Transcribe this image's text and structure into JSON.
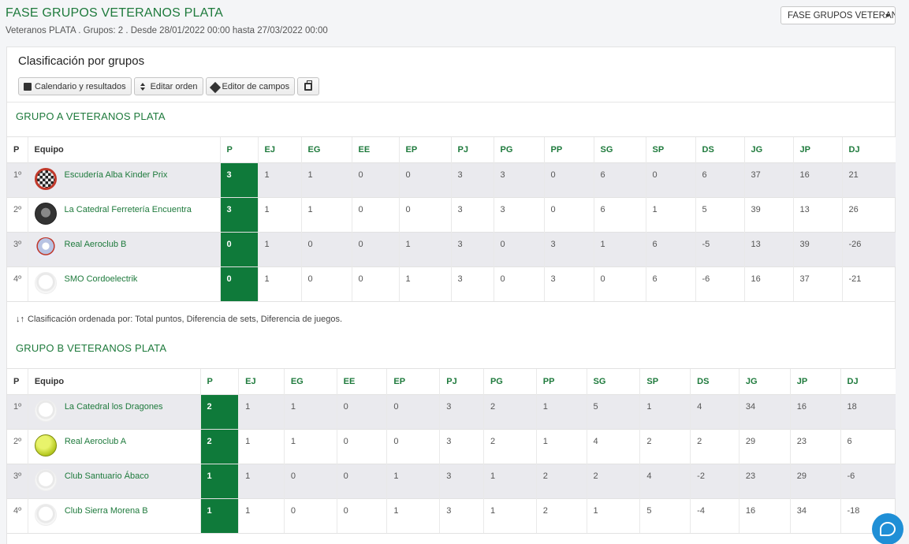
{
  "header": {
    "title": "FASE GRUPOS VETERANOS PLATA",
    "subtitle": "Veteranos PLATA . Grupos: 2 . Desde 28/01/2022 00:00 hasta 27/03/2022 00:00",
    "phase_select_value": "FASE GRUPOS VETERAN"
  },
  "panel": {
    "title": "Clasificación por grupos",
    "toolbar": {
      "calendar_label": "Calendario y resultados",
      "order_label": "Editar orden",
      "fields_label": "Editor de campos",
      "icons": [
        "calendar-icon",
        "sort-icon",
        "pencil-icon",
        "print-icon"
      ]
    }
  },
  "columns": [
    "P",
    "Equipo",
    "P",
    "EJ",
    "EG",
    "EE",
    "EP",
    "PJ",
    "PG",
    "PP",
    "SG",
    "SP",
    "DS",
    "JG",
    "JP",
    "DJ"
  ],
  "groups": [
    {
      "title": "GRUPO A VETERANOS PLATA",
      "rows": [
        {
          "pos": "1º",
          "team": "Escudería Alba Kinder Prix",
          "logo": "checker",
          "P": "3",
          "EJ": "1",
          "EG": "1",
          "EE": "0",
          "EP": "0",
          "PJ": "3",
          "PG": "3",
          "PP": "0",
          "SG": "6",
          "SP": "0",
          "DS": "6",
          "JG": "37",
          "JP": "16",
          "DJ": "21"
        },
        {
          "pos": "2º",
          "team": "La Catedral Ferretería Encuentra",
          "logo": "cathedral",
          "P": "3",
          "EJ": "1",
          "EG": "1",
          "EE": "0",
          "EP": "0",
          "PJ": "3",
          "PG": "3",
          "PP": "0",
          "SG": "6",
          "SP": "1",
          "DS": "5",
          "JG": "39",
          "JP": "13",
          "DJ": "26"
        },
        {
          "pos": "3º",
          "team": "Real Aeroclub B",
          "logo": "aero",
          "P": "0",
          "EJ": "1",
          "EG": "0",
          "EE": "0",
          "EP": "1",
          "PJ": "3",
          "PG": "0",
          "PP": "3",
          "SG": "1",
          "SP": "6",
          "DS": "-5",
          "JG": "13",
          "JP": "39",
          "DJ": "-26"
        },
        {
          "pos": "4º",
          "team": "SMO Cordoelectrik",
          "logo": "generic",
          "P": "0",
          "EJ": "1",
          "EG": "0",
          "EE": "0",
          "EP": "1",
          "PJ": "3",
          "PG": "0",
          "PP": "3",
          "SG": "0",
          "SP": "6",
          "DS": "-6",
          "JG": "16",
          "JP": "37",
          "DJ": "-21"
        }
      ],
      "sort_note": "Clasificación ordenada por: Total puntos, Diferencia de sets, Diferencia de juegos."
    },
    {
      "title": "GRUPO B VETERANOS PLATA",
      "rows": [
        {
          "pos": "1º",
          "team": "La Catedral los Dragones",
          "logo": "generic",
          "P": "2",
          "EJ": "1",
          "EG": "1",
          "EE": "0",
          "EP": "0",
          "PJ": "3",
          "PG": "2",
          "PP": "1",
          "SG": "5",
          "SP": "1",
          "DS": "4",
          "JG": "34",
          "JP": "16",
          "DJ": "18"
        },
        {
          "pos": "2º",
          "team": "Real Aeroclub A",
          "logo": "ball",
          "P": "2",
          "EJ": "1",
          "EG": "1",
          "EE": "0",
          "EP": "0",
          "PJ": "3",
          "PG": "2",
          "PP": "1",
          "SG": "4",
          "SP": "2",
          "DS": "2",
          "JG": "29",
          "JP": "23",
          "DJ": "6"
        },
        {
          "pos": "3º",
          "team": "Club Santuario Ábaco",
          "logo": "generic",
          "P": "1",
          "EJ": "1",
          "EG": "0",
          "EE": "0",
          "EP": "1",
          "PJ": "3",
          "PG": "1",
          "PP": "2",
          "SG": "2",
          "SP": "4",
          "DS": "-2",
          "JG": "23",
          "JP": "29",
          "DJ": "-6"
        },
        {
          "pos": "4º",
          "team": "Club Sierra Morena B",
          "logo": "generic",
          "P": "1",
          "EJ": "1",
          "EG": "0",
          "EE": "0",
          "EP": "1",
          "PJ": "3",
          "PG": "1",
          "PP": "2",
          "SG": "1",
          "SP": "5",
          "DS": "-4",
          "JG": "16",
          "JP": "34",
          "DJ": "-18"
        }
      ]
    }
  ],
  "colors": {
    "accent": "#1e7a3c",
    "points_cell": "#0f7a3a",
    "chat": "#1f8fd6"
  }
}
